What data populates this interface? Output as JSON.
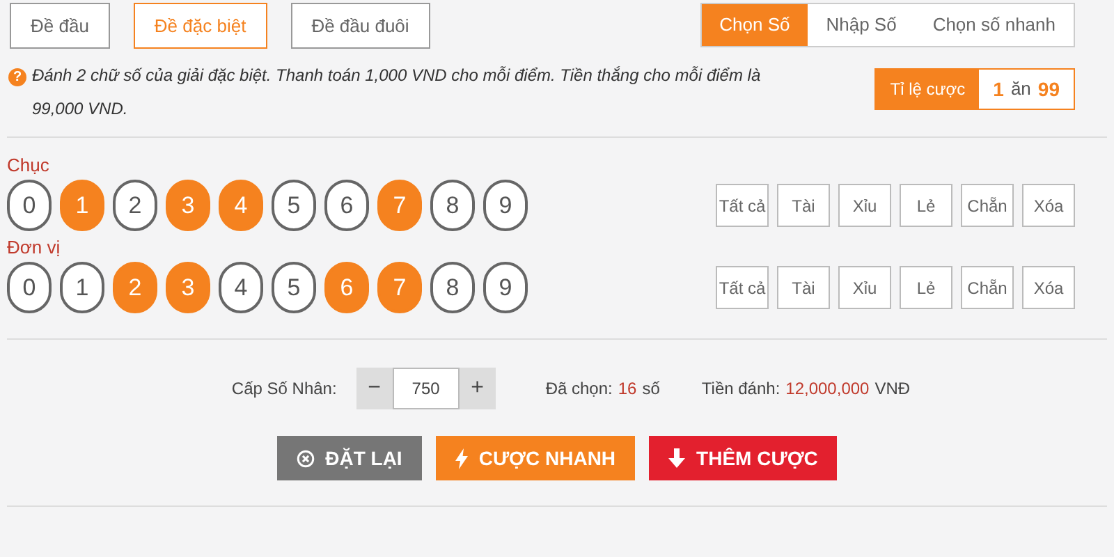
{
  "game_tabs": [
    {
      "label": "Đề đầu",
      "selected": false
    },
    {
      "label": "Đề đặc biệt",
      "selected": true
    },
    {
      "label": "Đề đầu đuôi",
      "selected": false
    }
  ],
  "mode_tabs": [
    {
      "label": "Chọn Số",
      "selected": true
    },
    {
      "label": "Nhập Số",
      "selected": false
    },
    {
      "label": "Chọn số nhanh",
      "selected": false
    }
  ],
  "info": {
    "icon": "?",
    "text": "Đánh 2 chữ số của giải đặc biệt. Thanh toán 1,000 VND cho mỗi điểm. Tiền thắng cho mỗi điểm là 99,000 VND."
  },
  "odds": {
    "label": "Tỉ lệ cược",
    "stake": "1",
    "word": "ăn",
    "payout": "99"
  },
  "rows": [
    {
      "label": "Chục",
      "digits": [
        {
          "label": "0",
          "selected": false
        },
        {
          "label": "1",
          "selected": true
        },
        {
          "label": "2",
          "selected": false
        },
        {
          "label": "3",
          "selected": true
        },
        {
          "label": "4",
          "selected": true
        },
        {
          "label": "5",
          "selected": false
        },
        {
          "label": "6",
          "selected": false
        },
        {
          "label": "7",
          "selected": true
        },
        {
          "label": "8",
          "selected": false
        },
        {
          "label": "9",
          "selected": false
        }
      ],
      "filters": [
        "Tất cả",
        "Tài",
        "Xỉu",
        "Lẻ",
        "Chẵn",
        "Xóa"
      ]
    },
    {
      "label": "Đơn vị",
      "digits": [
        {
          "label": "0",
          "selected": false
        },
        {
          "label": "1",
          "selected": false
        },
        {
          "label": "2",
          "selected": true
        },
        {
          "label": "3",
          "selected": true
        },
        {
          "label": "4",
          "selected": false
        },
        {
          "label": "5",
          "selected": false
        },
        {
          "label": "6",
          "selected": true
        },
        {
          "label": "7",
          "selected": true
        },
        {
          "label": "8",
          "selected": false
        },
        {
          "label": "9",
          "selected": false
        }
      ],
      "filters": [
        "Tất cả",
        "Tài",
        "Xỉu",
        "Lẻ",
        "Chẵn",
        "Xóa"
      ]
    }
  ],
  "multiplier": {
    "label": "Cấp Số Nhân:",
    "minus": "−",
    "value": "750",
    "plus": "+"
  },
  "chosen": {
    "label": "Đã chọn:",
    "count": "16",
    "unit": "số"
  },
  "amount": {
    "label": "Tiền đánh:",
    "value": "12,000,000",
    "currency": "VNĐ"
  },
  "actions": [
    {
      "kind": "reset",
      "label": "ĐẶT LẠI"
    },
    {
      "kind": "quick",
      "label": "CƯỢC NHANH"
    },
    {
      "kind": "add",
      "label": "THÊM CƯỢC"
    }
  ]
}
